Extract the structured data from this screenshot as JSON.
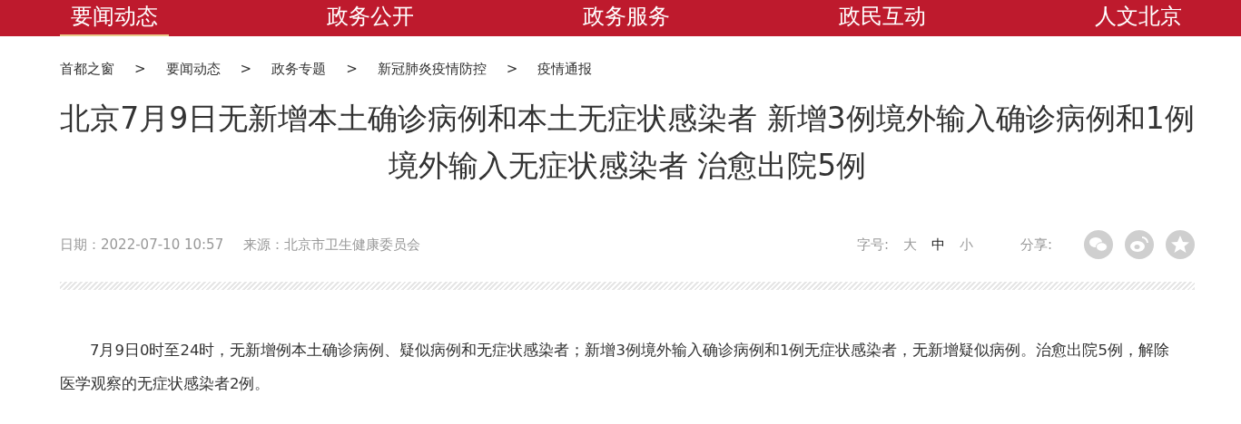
{
  "nav": [
    {
      "label": "要闻动态",
      "selected": true
    },
    {
      "label": "政务公开",
      "selected": false
    },
    {
      "label": "政务服务",
      "selected": false
    },
    {
      "label": "政民互动",
      "selected": false
    },
    {
      "label": "人文北京",
      "selected": false
    }
  ],
  "breadcrumb": [
    "首都之窗",
    "要闻动态",
    "政务专题",
    "新冠肺炎疫情防控",
    "疫情通报"
  ],
  "breadcrumb_separator": ">",
  "title": "北京7月9日无新增本土确诊病例和本土无症状感染者 新增3例境外输入确诊病例和1例境外输入无症状感染者 治愈出院5例",
  "meta": {
    "date": "日期：2022-07-10 10:57",
    "source": "来源：北京市卫生健康委员会"
  },
  "font_size": {
    "label": "字号:",
    "options": [
      {
        "label": "大",
        "selected": false
      },
      {
        "label": "中",
        "selected": true
      },
      {
        "label": "小",
        "selected": false
      }
    ]
  },
  "share": {
    "label": "分享:",
    "icons": [
      {
        "kind": "wechat"
      },
      {
        "kind": "weibo"
      },
      {
        "kind": "qzone"
      }
    ]
  },
  "body": "7月9日0时至24时，无新增例本土确诊病例、疑似病例和无症状感染者；新增3例境外输入确诊病例和1例无症状感染者，无新增疑似病例。治愈出院5例，解除医学观察的无症状感染者2例。"
}
